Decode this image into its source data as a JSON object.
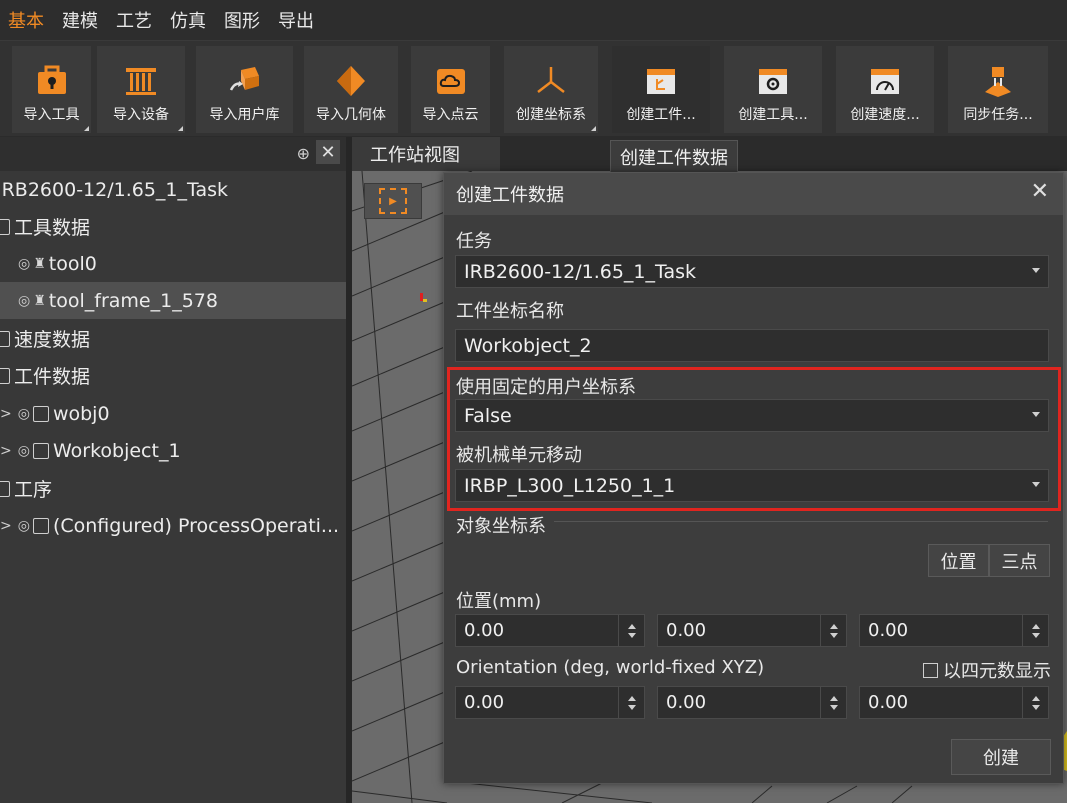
{
  "menu": [
    "基本",
    "建模",
    "工艺",
    "仿真",
    "图形",
    "导出"
  ],
  "menu_active_index": 0,
  "ribbon": [
    {
      "label": "导入工具",
      "icon": "tool-box-icon"
    },
    {
      "label": "导入设备",
      "icon": "device-icon"
    },
    {
      "label": "导入用户库",
      "icon": "user-library-icon"
    },
    {
      "label": "导入几何体",
      "icon": "geometry-icon"
    },
    {
      "label": "导入点云",
      "icon": "point-cloud-icon"
    },
    {
      "label": "创建坐标系",
      "icon": "coordinate-system-icon"
    },
    {
      "label": "创建工件...",
      "icon": "create-workobject-icon"
    },
    {
      "label": "创建工具...",
      "icon": "create-tool-icon"
    },
    {
      "label": "创建速度...",
      "icon": "create-speed-icon"
    },
    {
      "label": "同步任务...",
      "icon": "sync-task-icon"
    }
  ],
  "tree": [
    {
      "text": "IRB2600-12/1.65_1_Task",
      "level": 0
    },
    {
      "text": "工具数据",
      "level": 1
    },
    {
      "text": "tool0",
      "level": 2
    },
    {
      "text": "tool_frame_1_578",
      "level": 2
    },
    {
      "text": "速度数据",
      "level": 1
    },
    {
      "text": "工件数据",
      "level": 1
    },
    {
      "text": "wobj0",
      "level": 2
    },
    {
      "text": "Workobject_1",
      "level": 2
    },
    {
      "text": "工序",
      "level": 1
    },
    {
      "text": "(Configured) ProcessOperati...",
      "level": 2
    }
  ],
  "view_tab": "工作站视图",
  "tooltip": "创建工件数据",
  "dialog": {
    "title": "创建工件数据",
    "task_label": "任务",
    "task_value": "IRB2600-12/1.65_1_Task",
    "wobj_name_label": "工件坐标名称",
    "wobj_name_value": "Workobject_2",
    "fixed_uframe_label": "使用固定的用户坐标系",
    "fixed_uframe_value": "False",
    "moved_by_label": "被机械单元移动",
    "moved_by_value": "IRBP_L300_L1250_1_1",
    "object_frame_label": "对象坐标系",
    "seg_position": "位置",
    "seg_three_points": "三点",
    "position_label": "位置(mm)",
    "position": [
      "0.00",
      "0.00",
      "0.00"
    ],
    "orientation_label": "Orientation (deg, world-fixed XYZ)",
    "quaternion_label": "以四元数显示",
    "orientation": [
      "0.00",
      "0.00",
      "0.00"
    ],
    "create_button": "创建"
  },
  "colors": {
    "accent": "#f08a24",
    "highlight": "#e0251f"
  }
}
